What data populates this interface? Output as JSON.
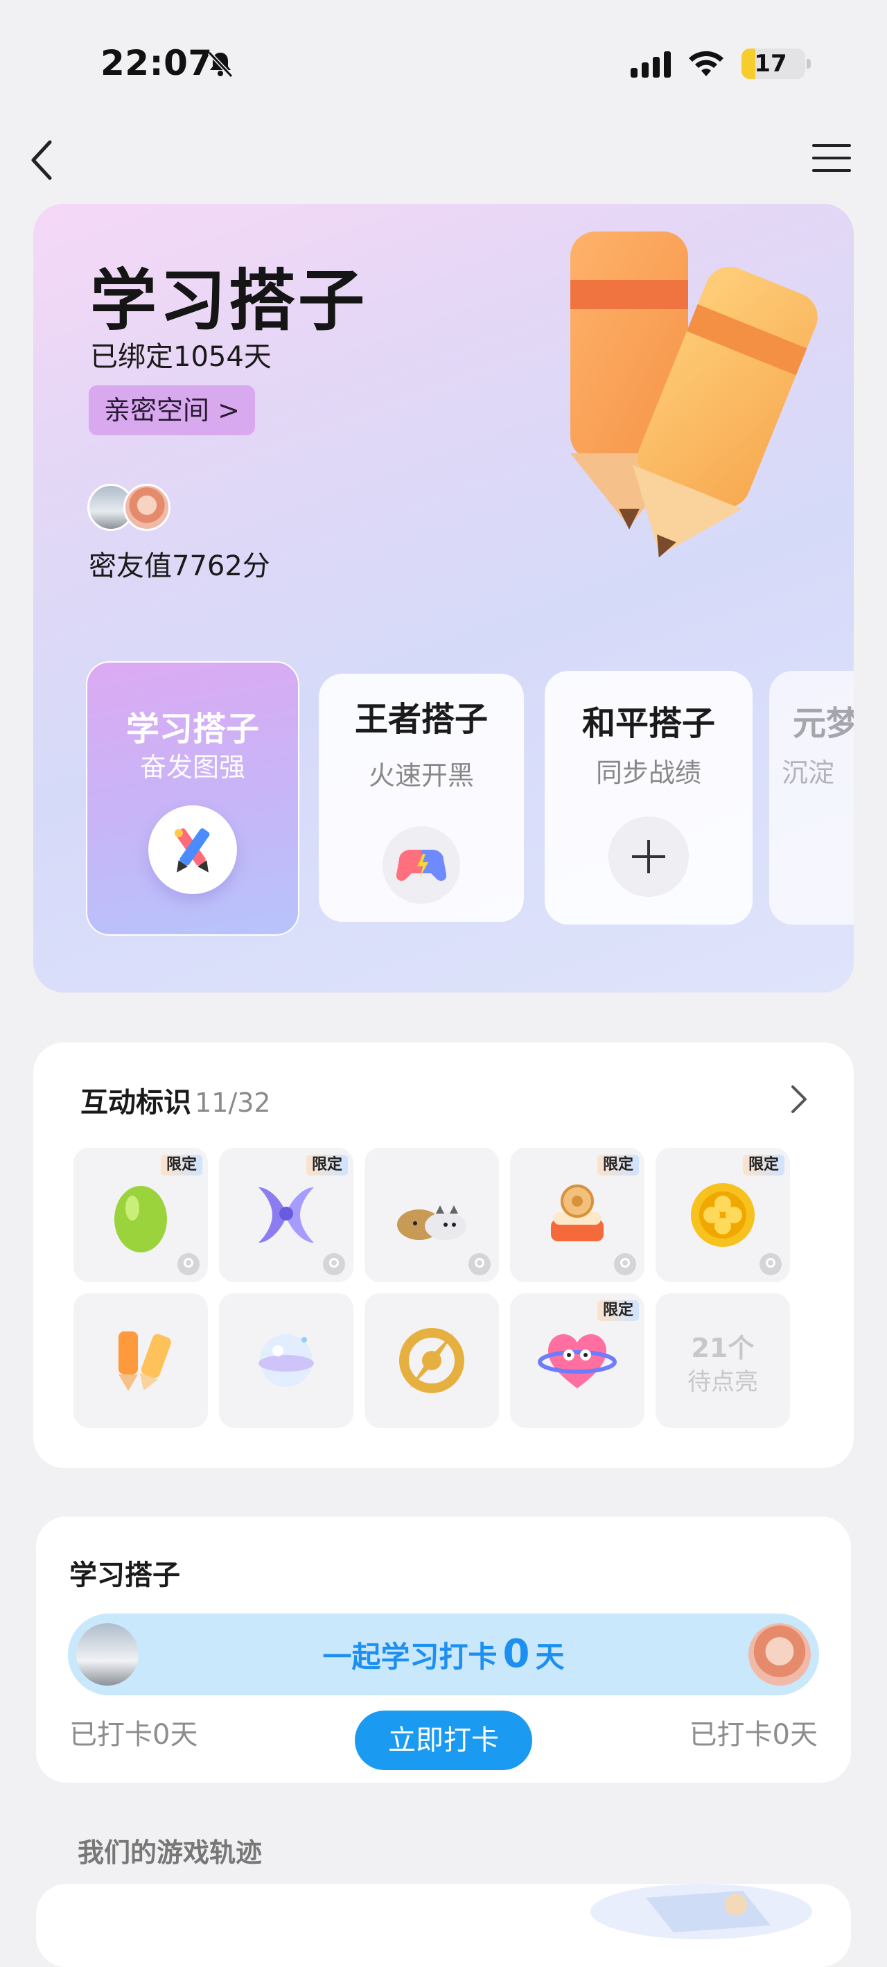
{
  "status_bar": {
    "time": "22:07",
    "battery": "17"
  },
  "hero": {
    "title": "学习搭子",
    "bound_days": "已绑定1054天",
    "intimate_space": "亲密空间 >",
    "score": "密友值7762分",
    "tiles": [
      {
        "title": "学习搭子",
        "subtitle": "奋发图强",
        "icon": "pencils-icon",
        "active": true
      },
      {
        "title": "王者搭子",
        "subtitle": "火速开黑",
        "icon": "gamepad-icon",
        "active": false
      },
      {
        "title": "和平搭子",
        "subtitle": "同步战绩",
        "icon": "plus-icon",
        "active": false
      },
      {
        "title": "元梦",
        "subtitle": "沉淀",
        "icon": "",
        "active": false
      }
    ]
  },
  "badges": {
    "title": "互动标识",
    "count": "11/32",
    "limit_label": "限定",
    "items": [
      {
        "name": "green-egg-badge",
        "limited": true,
        "locked": true
      },
      {
        "name": "purple-ribbon-badge",
        "limited": true,
        "locked": true
      },
      {
        "name": "cat-dog-badge",
        "limited": false,
        "locked": true
      },
      {
        "name": "cake-badge",
        "limited": true,
        "locked": true
      },
      {
        "name": "gold-coin-badge",
        "limited": true,
        "locked": true
      },
      {
        "name": "pencils-badge",
        "limited": false,
        "locked": false
      },
      {
        "name": "crystal-ball-badge",
        "limited": false,
        "locked": false
      },
      {
        "name": "gold-target-badge",
        "limited": false,
        "locked": false
      },
      {
        "name": "heart-planet-badge",
        "limited": true,
        "locked": false
      }
    ],
    "pending_count": "21个",
    "pending_label": "待点亮"
  },
  "checkin": {
    "title": "学习搭子",
    "progress_prefix": "一起学习打卡",
    "progress_days": "0",
    "progress_suffix": "天",
    "left_count": "已打卡0天",
    "right_count": "已打卡0天",
    "button": "立即打卡"
  },
  "track": {
    "title": "我们的游戏轨迹"
  },
  "colors": {
    "accent": "#1b9af1",
    "progress_bg": "#c9e8fb",
    "intimate_bg": "#d9a9f0"
  }
}
